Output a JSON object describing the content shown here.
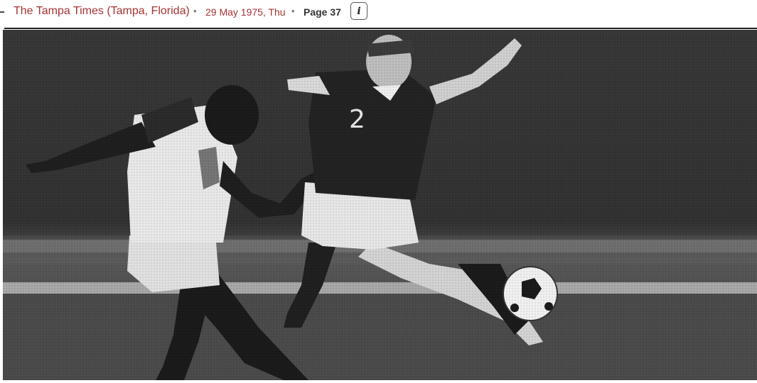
{
  "header": {
    "publication": "The Tampa Times (Tampa, Florida)",
    "separator": "•",
    "date": "29 May 1975, Thu",
    "page": "Page 37",
    "info_button": "i"
  },
  "photo": {
    "jersey_number": "2"
  },
  "icons": {
    "info": "info-icon"
  }
}
